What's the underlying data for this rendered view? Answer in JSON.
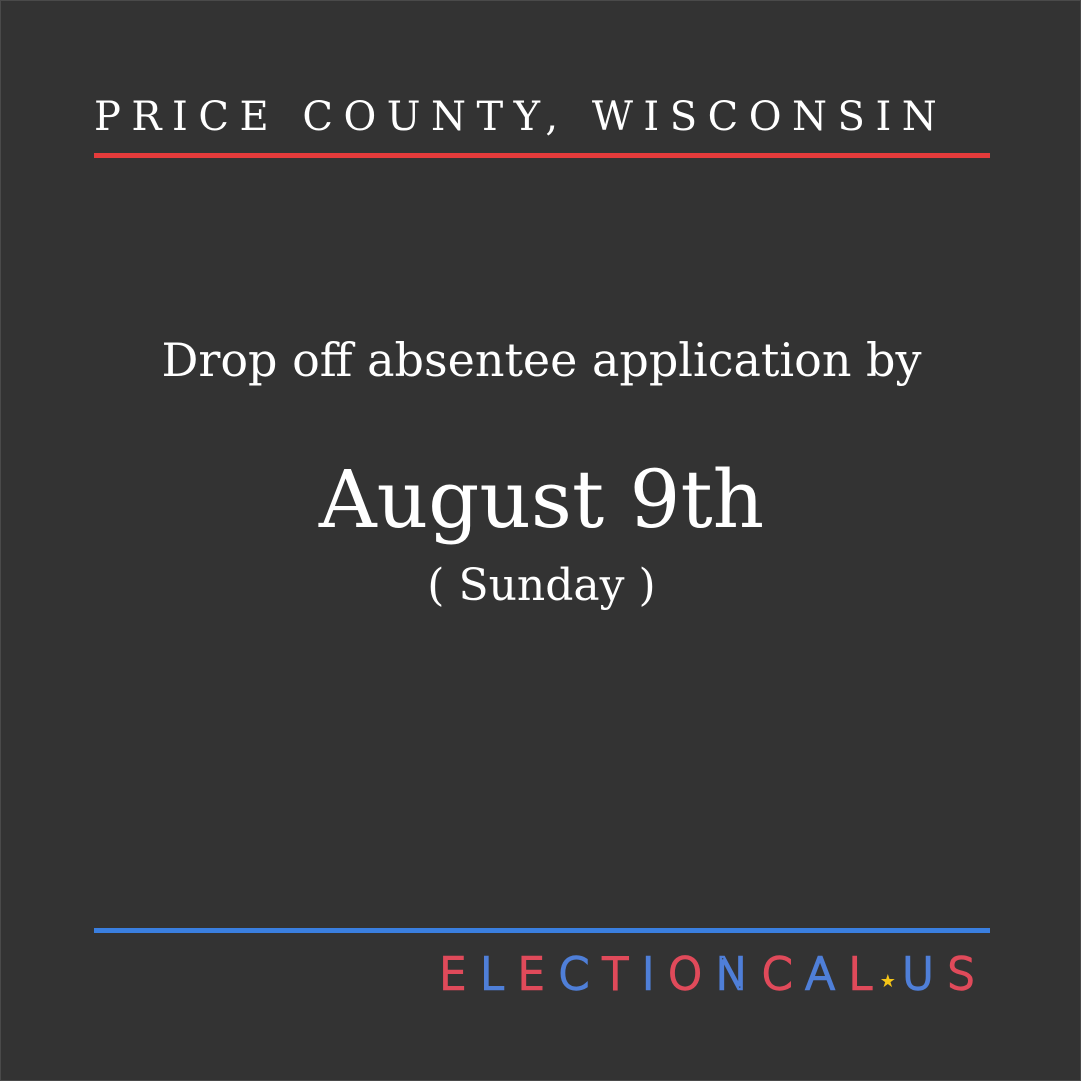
{
  "header": {
    "location": "PRICE COUNTY, WISCONSIN"
  },
  "main": {
    "headline": "Drop off absentee application by",
    "date": "August 9th",
    "weekday": "( Sunday )"
  },
  "footer": {
    "logo_prefix": "ELECTIONCAL",
    "logo_star": "★",
    "logo_suffix": "US"
  },
  "colors": {
    "background": "#333333",
    "top_rule": "#e53b3b",
    "bottom_rule": "#3a7fe0",
    "logo_red": "#e04a5a",
    "logo_blue": "#4f7fd8",
    "logo_star": "#f5c518"
  }
}
